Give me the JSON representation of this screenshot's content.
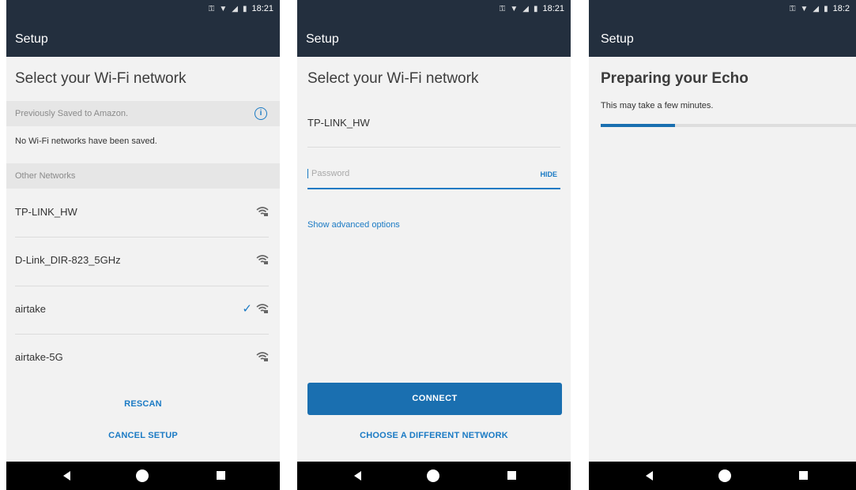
{
  "status_bar": {
    "time_left": "18:21",
    "time_middle": "18:21",
    "time_right": "18:2"
  },
  "app_title": "Setup",
  "screen1": {
    "heading": "Select your Wi-Fi network",
    "saved_section_label": "Previously Saved to Amazon.",
    "saved_empty_message": "No Wi-Fi networks have been saved.",
    "other_section_label": "Other Networks",
    "networks": [
      {
        "name": "TP-LINK_HW",
        "icon": "wifi-locked-icon",
        "selected": false
      },
      {
        "name": "D-Link_DIR-823_5GHz",
        "icon": "wifi-locked-icon",
        "selected": false
      },
      {
        "name": "airtake",
        "icon": "wifi-locked-icon",
        "selected": true
      },
      {
        "name": "airtake-5G",
        "icon": "wifi-locked-icon",
        "selected": false
      }
    ],
    "rescan_label": "RESCAN",
    "cancel_label": "CANCEL SETUP"
  },
  "screen2": {
    "heading": "Select your Wi-Fi network",
    "ssid": "TP-LINK_HW",
    "password_placeholder": "Password",
    "password_value": "",
    "hide_label": "HIDE",
    "advanced_label": "Show advanced options",
    "connect_label": "CONNECT",
    "choose_label": "CHOOSE A DIFFERENT NETWORK"
  },
  "screen3": {
    "heading": "Preparing your Echo",
    "subtext": "This may take a few minutes.",
    "progress_fraction": 0.29
  },
  "colors": {
    "appbar": "#232f3e",
    "accent": "#1a7ac4",
    "button": "#1a6fb0",
    "background": "#f2f2f2"
  }
}
